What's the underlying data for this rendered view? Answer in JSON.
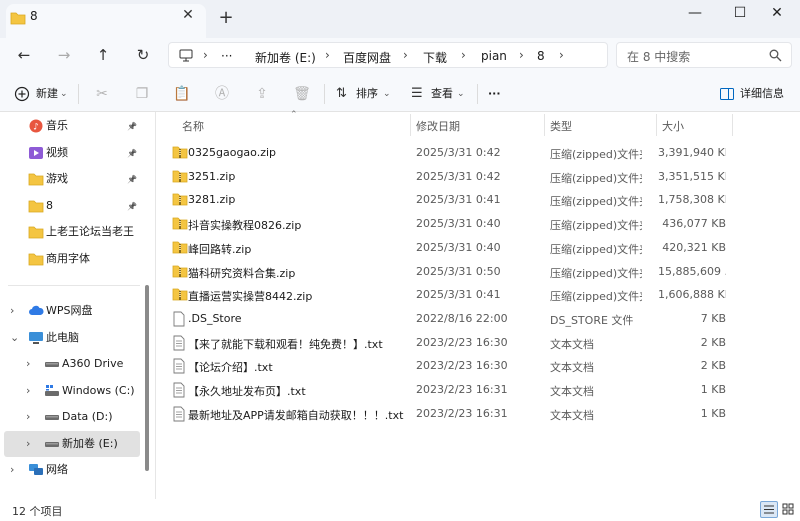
{
  "window": {
    "tab_title": "8",
    "close_tab": "✕",
    "new_tab": "+",
    "minimize": "—",
    "maximize": "☐",
    "close": "✕"
  },
  "nav": {
    "back": "←",
    "forward": "→",
    "up": "↑",
    "refresh": "↻",
    "more_crumbs": "···",
    "breadcrumbs": [
      "新加卷 (E:)",
      "百度网盘",
      "下载",
      "pian",
      "8"
    ],
    "search_placeholder": "在 8 中搜索"
  },
  "toolbar": {
    "new_label": "新建",
    "sort_label": "排序",
    "view_label": "查看",
    "more_label": "···",
    "details_label": "详细信息"
  },
  "sidebar": {
    "quick_access": [
      {
        "label": "音乐",
        "icon": "music-icon",
        "pinned": true
      },
      {
        "label": "视频",
        "icon": "video-icon",
        "pinned": true
      },
      {
        "label": "游戏",
        "icon": "folder-icon",
        "pinned": true
      },
      {
        "label": "8",
        "icon": "folder-icon",
        "pinned": true
      },
      {
        "label": "上老王论坛当老王",
        "icon": "folder-icon",
        "pinned": false
      },
      {
        "label": "商用字体",
        "icon": "folder-icon",
        "pinned": false
      }
    ],
    "tree": [
      {
        "label": "WPS网盘",
        "icon": "cloud-icon",
        "expander": "›",
        "indent": 0
      },
      {
        "label": "此电脑",
        "icon": "computer-icon",
        "expander": "⌄",
        "indent": 0
      },
      {
        "label": "A360 Drive",
        "icon": "drive-icon",
        "expander": "›",
        "indent": 1
      },
      {
        "label": "Windows (C:)",
        "icon": "windows-drive-icon",
        "expander": "›",
        "indent": 1
      },
      {
        "label": "Data (D:)",
        "icon": "drive-icon",
        "expander": "›",
        "indent": 1
      },
      {
        "label": "新加卷 (E:)",
        "icon": "drive-icon",
        "expander": "›",
        "indent": 1,
        "active": true
      },
      {
        "label": "网络",
        "icon": "network-icon",
        "expander": "›",
        "indent": 0
      }
    ]
  },
  "columns": {
    "name": "名称",
    "modified": "修改日期",
    "type": "类型",
    "size": "大小"
  },
  "files": [
    {
      "name": "0325gaogao.zip",
      "modified": "2025/3/31 0:42",
      "type": "压缩(zipped)文件夹",
      "size": "3,391,940 KB",
      "kind": "zip"
    },
    {
      "name": "3251.zip",
      "modified": "2025/3/31 0:42",
      "type": "压缩(zipped)文件夹",
      "size": "3,351,515 KB",
      "kind": "zip"
    },
    {
      "name": "3281.zip",
      "modified": "2025/3/31 0:41",
      "type": "压缩(zipped)文件夹",
      "size": "1,758,308 KB",
      "kind": "zip"
    },
    {
      "name": "抖音实操教程0826.zip",
      "modified": "2025/3/31 0:40",
      "type": "压缩(zipped)文件夹",
      "size": "436,077 KB",
      "kind": "zip"
    },
    {
      "name": "峰回路转.zip",
      "modified": "2025/3/31 0:40",
      "type": "压缩(zipped)文件夹",
      "size": "420,321 KB",
      "kind": "zip"
    },
    {
      "name": "猫科研究资料合集.zip",
      "modified": "2025/3/31 0:50",
      "type": "压缩(zipped)文件夹",
      "size": "15,885,609 ...",
      "kind": "zip"
    },
    {
      "name": "直播运营实操营8442.zip",
      "modified": "2025/3/31 0:41",
      "type": "压缩(zipped)文件夹",
      "size": "1,606,888 KB",
      "kind": "zip"
    },
    {
      "name": ".DS_Store",
      "modified": "2022/8/16 22:00",
      "type": "DS_STORE 文件",
      "size": "7 KB",
      "kind": "file"
    },
    {
      "name": "【来了就能下载和观看！纯免费！】.txt",
      "modified": "2023/2/23 16:30",
      "type": "文本文档",
      "size": "2 KB",
      "kind": "txt"
    },
    {
      "name": "【论坛介绍】.txt",
      "modified": "2023/2/23 16:30",
      "type": "文本文档",
      "size": "2 KB",
      "kind": "txt"
    },
    {
      "name": "【永久地址发布页】.txt",
      "modified": "2023/2/23 16:31",
      "type": "文本文档",
      "size": "1 KB",
      "kind": "txt"
    },
    {
      "name": "最新地址及APP请发邮箱自动获取！！！.txt",
      "modified": "2023/2/23 16:31",
      "type": "文本文档",
      "size": "1 KB",
      "kind": "txt"
    }
  ],
  "status": {
    "item_count": "12 个项目"
  },
  "colors": {
    "folder": "#f4c542",
    "accent": "#0067c0"
  }
}
